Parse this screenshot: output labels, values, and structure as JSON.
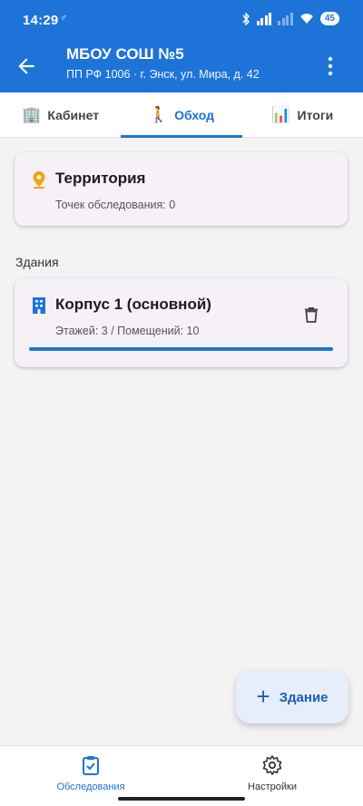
{
  "status_bar": {
    "time": "14:29",
    "battery": "45"
  },
  "app_bar": {
    "title": "МБОУ СОШ №5",
    "subtitle": "ПП РФ 1006 · г. Энск, ул. Мира, д. 42"
  },
  "tabs": [
    {
      "label": "Кабинет",
      "icon": "🏢"
    },
    {
      "label": "Обход",
      "icon": "🚶"
    },
    {
      "label": "Итоги",
      "icon": "📊"
    }
  ],
  "territory": {
    "title": "Территория",
    "subtitle": "Точек обследования: 0"
  },
  "buildings_section": {
    "label": "Здания"
  },
  "buildings": [
    {
      "title": "Корпус 1 (основной)",
      "subtitle": "Этажей: 3 / Помещений: 10",
      "progress_percent": 100
    }
  ],
  "fab": {
    "label": "Здание"
  },
  "bottom_nav": [
    {
      "label": "Обследования"
    },
    {
      "label": "Настройки"
    }
  ],
  "colors": {
    "primary": "#1e73d8",
    "territory_icon": "#f0a410",
    "card_bg": "#f6f0f7"
  }
}
